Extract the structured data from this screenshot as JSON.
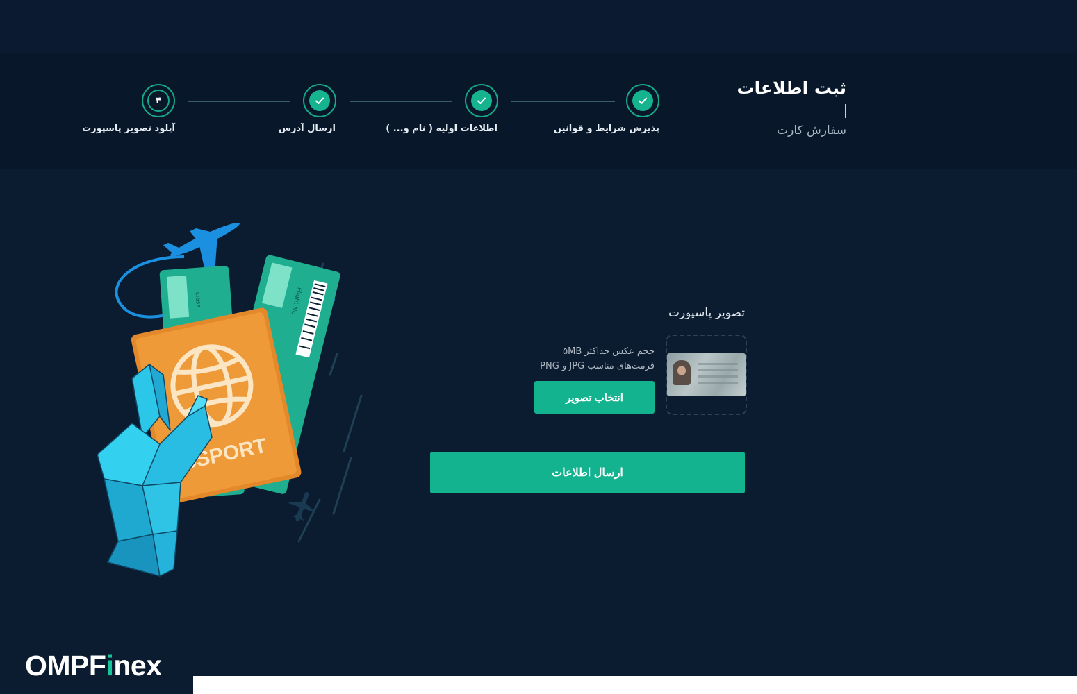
{
  "header": {
    "title": "ثبت اطلاعات",
    "subtitle": "سفارش کارت"
  },
  "steps": [
    {
      "label": "پذیرش شرایط و قوانین",
      "state": "done",
      "icon": "check-icon"
    },
    {
      "label": "اطلاعات اولیه ( نام و... )",
      "state": "done",
      "icon": "check-icon"
    },
    {
      "label": "ارسال آدرس",
      "state": "done",
      "icon": "check-icon"
    },
    {
      "label": "آپلود تصویر پاسپورت",
      "state": "current",
      "number": "۴"
    }
  ],
  "upload": {
    "title": "تصویر پاسپورت",
    "hint_size": "حجم عکس حداکثر ۵MB",
    "hint_format": "فرمت‌های مناسب JPG و PNG",
    "choose_label": "انتخاب تصویر"
  },
  "submit_label": "ارسال اطلاعات",
  "illustration": {
    "passport_text": "SSPORT",
    "ticket_text_1": "class",
    "ticket_text_2": "Flight No"
  },
  "brand": {
    "logo_part1": "OMPF",
    "logo_accent": "i",
    "logo_part2": "nex"
  },
  "colors": {
    "accent": "#14b38f",
    "background": "#0c1c30",
    "header_bg": "#08172a"
  }
}
